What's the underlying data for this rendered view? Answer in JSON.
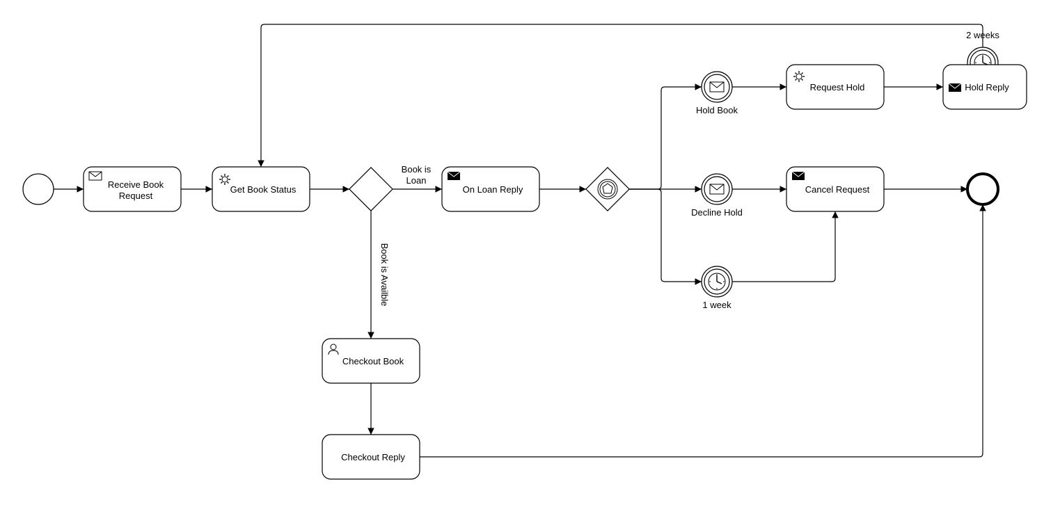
{
  "tasks": {
    "receiveBookRequest": "Receive Book\nRequest",
    "getBookStatus": "Get Book Status",
    "onLoanReply": "On Loan Reply",
    "requestHold": "Request Hold",
    "holdReply": "Hold Reply",
    "cancelRequest": "Cancel Request",
    "checkoutBook": "Checkout Book",
    "checkoutReply": "Checkout Reply"
  },
  "events": {
    "holdBook": "Hold Book",
    "declineHold": "Decline Hold",
    "oneWeek": "1 week",
    "twoWeeks": "2 weeks"
  },
  "edges": {
    "bookIsLoan": "Book is\nLoan",
    "bookIsAvailable": "Book is Availble"
  }
}
